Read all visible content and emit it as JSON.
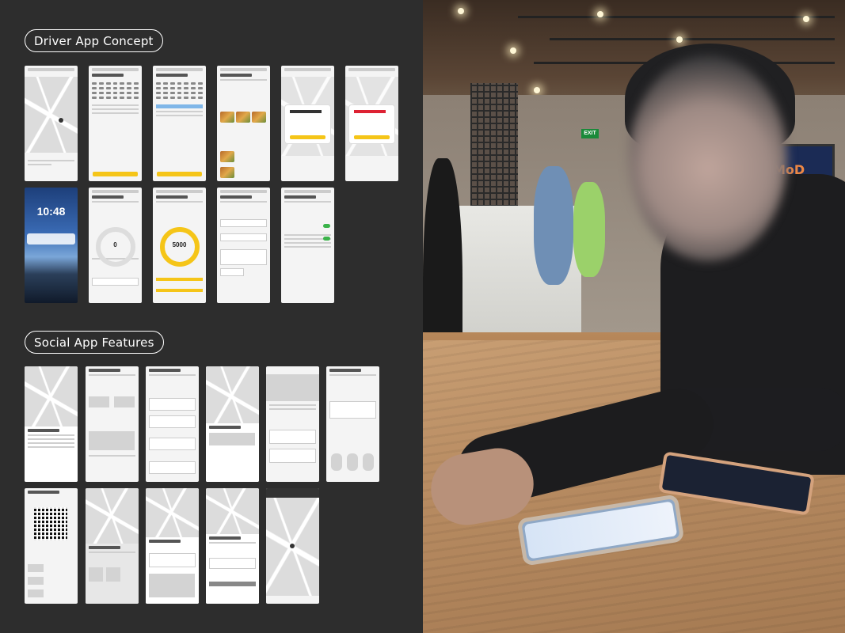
{
  "sections": {
    "driver_title": "Driver App Concept",
    "social_title": "Social App Features"
  },
  "driver_screens": {
    "lock_time": "10:48",
    "steps_empty": "0",
    "steps_goal": "5000"
  },
  "photo": {
    "exit_sign": "EXIT",
    "store_sign": "MoD"
  },
  "colors": {
    "background": "#2d2d2d",
    "accent_yellow": "#f5c518",
    "toggle_green": "#3bb34a"
  }
}
